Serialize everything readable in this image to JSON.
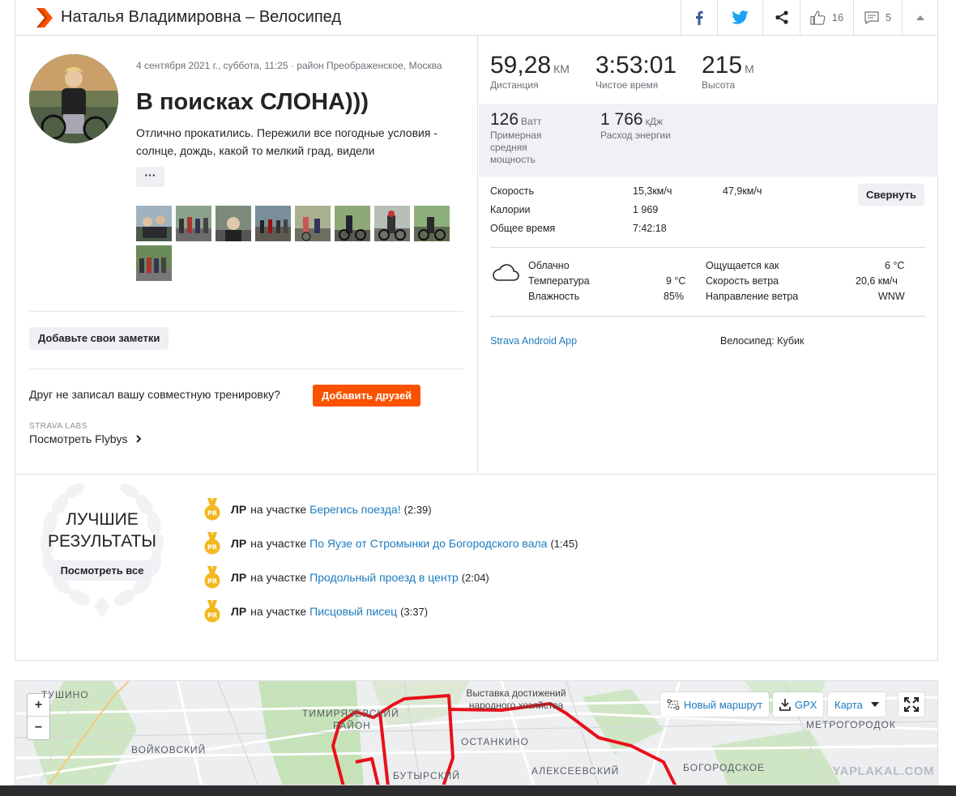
{
  "header": {
    "title": "Наталья Владимировна – Велосипед",
    "likes": "16",
    "comments": "5"
  },
  "activity": {
    "date_location": "4 сентября 2021 г., суббота, 11:25 · район Преображенское, Москва",
    "name": "В поисках СЛОНА)))",
    "description": "Отлично прокатились. Пережили все погодные условия - солнце, дождь, какой то мелкий град, видели",
    "more": "···",
    "add_notes": "Добавьте свои заметки",
    "friend_text": "Друг не записал вашу совместную тренировку?",
    "add_friends": "Добавить друзей",
    "labs_label": "STRAVA LABS",
    "flybys": "Посмотреть Flybys"
  },
  "stats": {
    "distance": {
      "value": "59,28",
      "unit": "КМ",
      "label": "Дистанция"
    },
    "moving_time": {
      "value": "3:53:01",
      "label": "Чистое время"
    },
    "elevation": {
      "value": "215",
      "unit": "М",
      "label": "Высота"
    },
    "power": {
      "value": "126",
      "unit": "Ватт",
      "label": "Примерная средняя мощность"
    },
    "energy": {
      "value": "1 766",
      "unit": "кДж",
      "label": "Расход энергии"
    },
    "speed_label": "Скорость",
    "speed_avg": "15,3км/ч",
    "speed_max": "47,9км/ч",
    "calories_label": "Калории",
    "calories": "1 969",
    "elapsed_label": "Общее время",
    "elapsed": "7:42:18",
    "collapse": "Свернуть"
  },
  "weather": {
    "condition": "Облачно",
    "temp_label": "Температура",
    "temp": "9 °C",
    "humidity_label": "Влажность",
    "humidity": "85%",
    "feels_label": "Ощущается как",
    "feels": "6 °C",
    "wind_speed_label": "Скорость ветра",
    "wind_speed": "20,6 км/ч",
    "wind_dir_label": "Направление ветра",
    "wind_dir": "WNW"
  },
  "device": {
    "app": "Strava Android App",
    "bike": "Велосипед: Кубик"
  },
  "best": {
    "title_line1": "ЛУЧШИЕ",
    "title_line2": "РЕЗУЛЬТАТЫ",
    "see_all": "Посмотреть все",
    "pr_label": "ЛР",
    "on_segment": "на участке",
    "items": [
      {
        "segment": "Берегись поезда!",
        "time": "(2:39)"
      },
      {
        "segment": "По Яузе от Стромынки до Богородского вала",
        "time": "(1:45)"
      },
      {
        "segment": "Продольный проезд в центр",
        "time": "(2:04)"
      },
      {
        "segment": "Писцовый писец",
        "time": "(3:37)"
      }
    ]
  },
  "map": {
    "zoom_in": "+",
    "zoom_out": "−",
    "new_route": "Новый маршрут",
    "gpx": "GPX",
    "map_type": "Карта",
    "labels": {
      "tushino": "ТУШИНО",
      "timiryazevsky": "ТИМИРЯЗЕВСКИЙ",
      "rayon": "РАЙОН",
      "voykovsky": "ВОЙКОВСКИЙ",
      "vdnh": "Выставка достижений народного хозяйства",
      "ostankino": "ОСТАНКИНО",
      "alekseevsky": "АЛЕКСЕЕВСКИЙ",
      "butyrsky": "БУТЫРСКИЙ",
      "metrogorodok": "МЕТРОГОРОДОК",
      "bogorodskoe": "БОГОРОДСКОЕ"
    },
    "watermark": "YAPLAKAL.COM"
  },
  "colors": {
    "brand": "#fc5200",
    "link": "#1e7bbf",
    "route": "#e8101a"
  }
}
